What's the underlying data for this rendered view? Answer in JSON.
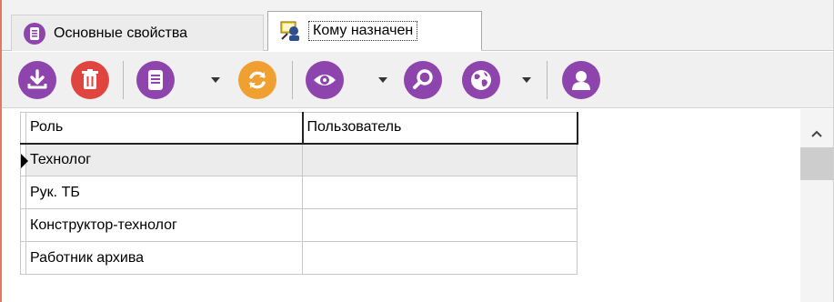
{
  "tabs": [
    {
      "label": "Основные свойства",
      "icon": "document-circle-icon",
      "active": false
    },
    {
      "label": "Кому назначен",
      "icon": "user-assign-icon",
      "active": true
    }
  ],
  "toolbar": {
    "buttons": [
      {
        "name": "download-icon",
        "color": "#8e44ad"
      },
      {
        "name": "trash-icon",
        "color": "#e0443e"
      },
      {
        "name": "document-icon",
        "color": "#8e44ad"
      },
      {
        "name": "refresh-icon",
        "color": "#f0a030"
      },
      {
        "name": "eye-icon",
        "color": "#8e44ad"
      },
      {
        "name": "search-icon",
        "color": "#8e44ad"
      },
      {
        "name": "globe-icon",
        "color": "#8e44ad"
      },
      {
        "name": "user-icon",
        "color": "#8e44ad"
      }
    ]
  },
  "grid": {
    "columns": [
      "Роль",
      "Пользователь"
    ],
    "rows": [
      {
        "role": "Технолог",
        "user": ""
      },
      {
        "role": "Рук. ТБ",
        "user": ""
      },
      {
        "role": "Конструктор-технолог",
        "user": ""
      },
      {
        "role": "Работник архива",
        "user": ""
      }
    ],
    "current_row": 0
  },
  "colors": {
    "accent_purple": "#8e44ad",
    "accent_red": "#e0443e",
    "accent_orange": "#f0a030",
    "frame_border": "#e4766b"
  }
}
